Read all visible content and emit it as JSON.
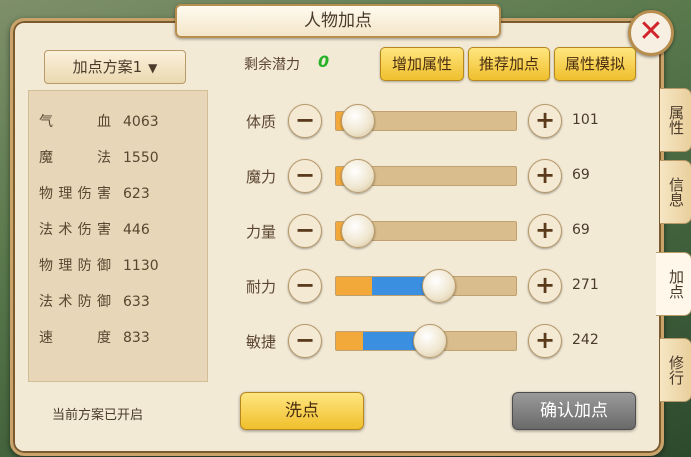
{
  "window": {
    "title": "人物加点",
    "close_icon": "close-icon"
  },
  "scheme": {
    "selected": "加点方案1",
    "chevron_icon": "chevron-down-icon",
    "status": "当前方案已开启"
  },
  "stats": [
    {
      "label": "气血",
      "value": "4063"
    },
    {
      "label": "魔法",
      "value": "1550"
    },
    {
      "label": "物理伤害",
      "value": "623"
    },
    {
      "label": "法术伤害",
      "value": "446"
    },
    {
      "label": "物理防御",
      "value": "1130"
    },
    {
      "label": "法术防御",
      "value": "633"
    },
    {
      "label": "速度",
      "value": "833"
    }
  ],
  "potential": {
    "label": "剩余潜力",
    "value": "0"
  },
  "top_buttons": {
    "add_attr": "增加属性",
    "recommend": "推荐加点",
    "simulate": "属性模拟"
  },
  "attributes": [
    {
      "label": "体质",
      "value": "101",
      "base_fraction": 0.12,
      "added_fraction": 0.0
    },
    {
      "label": "魔力",
      "value": "69",
      "base_fraction": 0.12,
      "added_fraction": 0.0
    },
    {
      "label": "力量",
      "value": "69",
      "base_fraction": 0.12,
      "added_fraction": 0.0
    },
    {
      "label": "耐力",
      "value": "271",
      "base_fraction": 0.2,
      "added_fraction": 0.37
    },
    {
      "label": "敏捷",
      "value": "242",
      "base_fraction": 0.15,
      "added_fraction": 0.37
    }
  ],
  "actions": {
    "wash": "洗点",
    "confirm": "确认加点"
  },
  "side_tabs": [
    {
      "label": "属性",
      "active": false
    },
    {
      "label": "信息",
      "active": false
    },
    {
      "label": "加点",
      "active": true
    },
    {
      "label": "修行",
      "active": false
    }
  ],
  "colors": {
    "fill_orange": "#f2a93a",
    "fill_blue": "#3a8fe0",
    "potential_green": "#27b227",
    "close_red": "#d2232a"
  }
}
